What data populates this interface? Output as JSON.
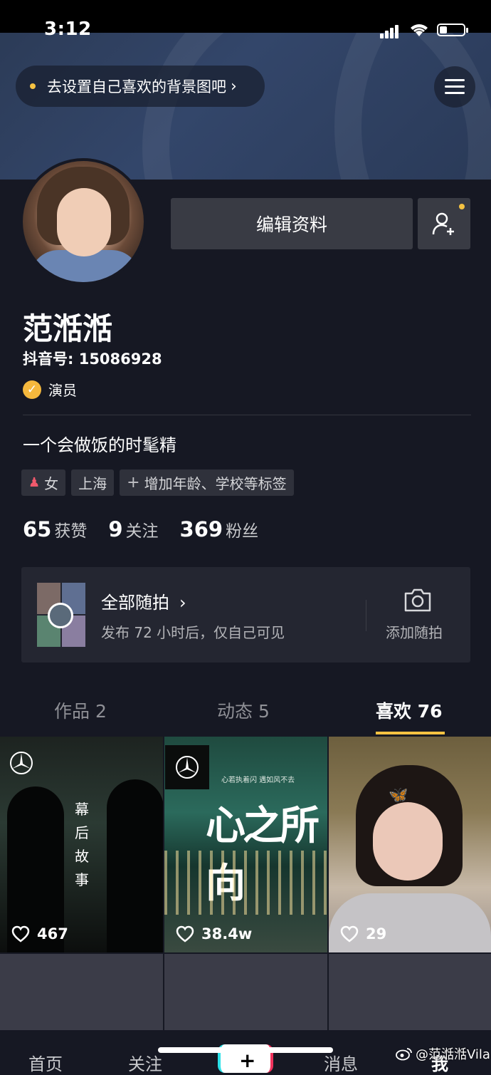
{
  "status_bar": {
    "time": "3:12"
  },
  "header": {
    "bg_hint": "去设置自己喜欢的背景图吧",
    "bg_hint_chevron": "›"
  },
  "profile": {
    "edit_label": "编辑资料",
    "name": "范湉湉",
    "douyin_id": "抖音号: 15086928",
    "verified_label": "演员",
    "bio": "一个会做饭的时髦精",
    "tags": {
      "gender": "女",
      "city": "上海",
      "add": "增加年龄、学校等标签"
    }
  },
  "stats": [
    {
      "num": "65",
      "label": "获赞"
    },
    {
      "num": "9",
      "label": "关注"
    },
    {
      "num": "369",
      "label": "粉丝"
    }
  ],
  "random": {
    "title": "全部随拍",
    "arrow": "›",
    "subtitle": "发布 72 小时后，仅自己可见",
    "add_label": "添加随拍"
  },
  "tabs": [
    {
      "label": "作品 2",
      "active": false
    },
    {
      "label": "动态 5",
      "active": false
    },
    {
      "label": "喜欢 76",
      "active": true
    }
  ],
  "videos": [
    {
      "likes": "467",
      "overlay_text": "幕后故事"
    },
    {
      "likes": "38.4w",
      "overlay_title": "心之所向",
      "overlay_tag": "心若执着闪 遇如风不去"
    },
    {
      "likes": "29"
    }
  ],
  "bottom_nav": {
    "home": "首页",
    "follow": "关注",
    "plus": "+",
    "messages": "消息",
    "me": "我"
  },
  "watermark": "@范湉湉Vila",
  "colors": {
    "accent": "#f5c242",
    "background": "#161823",
    "card": "#242631",
    "button": "#393b44"
  }
}
